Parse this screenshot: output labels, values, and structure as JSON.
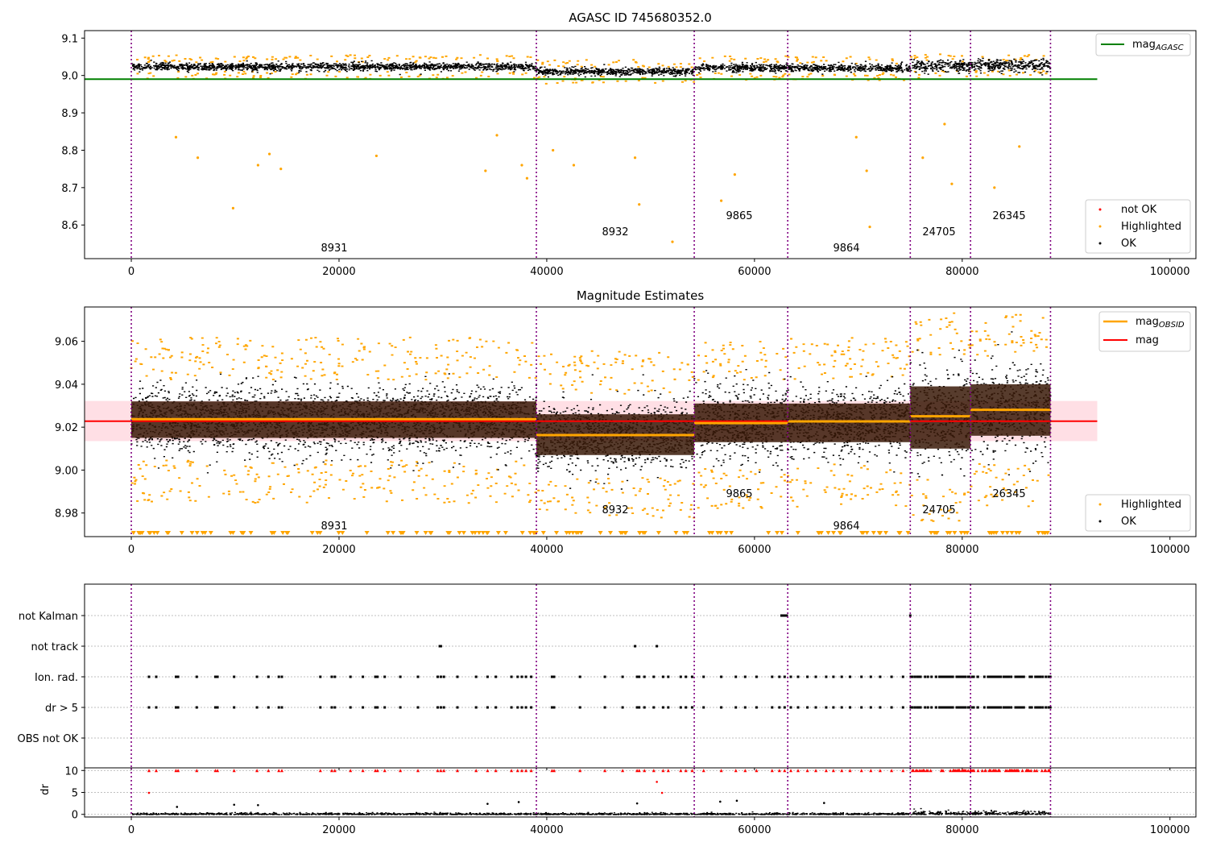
{
  "figure": {
    "obsid_labels": [
      "8931",
      "8932",
      "9865",
      "9864",
      "24705",
      "26345"
    ],
    "obs_boundaries": [
      0,
      39000,
      54200,
      63200,
      75000,
      80800,
      88500
    ]
  },
  "chart_data": [
    {
      "type": "scatter",
      "title": "AGASC ID 745680352.0",
      "xlabel": "",
      "ylabel": "",
      "xlim": [
        -4500,
        102500
      ],
      "ylim": [
        8.51,
        9.12
      ],
      "xticks": [
        "0",
        "20000",
        "40000",
        "60000",
        "80000",
        "100000"
      ],
      "yticks": [
        "8.6",
        "8.7",
        "8.8",
        "8.9",
        "9.0",
        "9.1"
      ],
      "mag_agasc": 8.99,
      "legend": {
        "position": "top-right",
        "entries": [
          "mag_AGASC"
        ]
      },
      "legend2": {
        "position": "bottom-right",
        "entries": [
          "not OK",
          "Highlighted",
          "OK"
        ]
      },
      "band_means": [
        9.025,
        9.012,
        9.022,
        9.021,
        9.027,
        9.028
      ],
      "highlighted_outliers": [
        {
          "x": 9800,
          "y": 8.645
        },
        {
          "x": 6400,
          "y": 8.78
        },
        {
          "x": 4300,
          "y": 8.835
        },
        {
          "x": 12200,
          "y": 8.76
        },
        {
          "x": 13300,
          "y": 8.79
        },
        {
          "x": 14400,
          "y": 8.75
        },
        {
          "x": 23600,
          "y": 8.785
        },
        {
          "x": 34100,
          "y": 8.745
        },
        {
          "x": 35200,
          "y": 8.84
        },
        {
          "x": 37600,
          "y": 8.76
        },
        {
          "x": 38100,
          "y": 8.725
        },
        {
          "x": 42600,
          "y": 8.76
        },
        {
          "x": 40600,
          "y": 8.8
        },
        {
          "x": 48500,
          "y": 8.78
        },
        {
          "x": 48900,
          "y": 8.655
        },
        {
          "x": 52100,
          "y": 8.555
        },
        {
          "x": 56800,
          "y": 8.665
        },
        {
          "x": 58100,
          "y": 8.735
        },
        {
          "x": 70800,
          "y": 8.745
        },
        {
          "x": 71100,
          "y": 8.595
        },
        {
          "x": 69800,
          "y": 8.835
        },
        {
          "x": 76200,
          "y": 8.78
        },
        {
          "x": 79000,
          "y": 8.71
        },
        {
          "x": 83100,
          "y": 8.7
        },
        {
          "x": 85500,
          "y": 8.81
        },
        {
          "x": 78300,
          "y": 8.87
        }
      ]
    },
    {
      "type": "scatter",
      "title": "Magnitude Estimates",
      "xlabel": "",
      "ylabel": "",
      "xlim": [
        -4500,
        102500
      ],
      "ylim": [
        8.969,
        9.076
      ],
      "xticks": [
        "0",
        "20000",
        "40000",
        "60000",
        "80000",
        "100000"
      ],
      "yticks": [
        "8.98",
        "9.00",
        "9.02",
        "9.04",
        "9.06"
      ],
      "mag": 9.0228,
      "mag_band": [
        9.0135,
        9.0322
      ],
      "legend": {
        "position": "top-right",
        "entries": [
          "mag_OBSID",
          "mag"
        ]
      },
      "legend2": {
        "position": "bottom-right",
        "entries": [
          "Highlighted",
          "OK"
        ]
      },
      "mag_obsid": [
        9.0237,
        9.0163,
        9.0219,
        9.0227,
        9.0251,
        9.0281
      ],
      "obs_bands": [
        {
          "lo": 9.015,
          "hi": 9.032
        },
        {
          "lo": 9.007,
          "hi": 9.026
        },
        {
          "lo": 9.013,
          "hi": 9.031
        },
        {
          "lo": 9.013,
          "hi": 9.031
        },
        {
          "lo": 9.01,
          "hi": 9.039
        },
        {
          "lo": 9.016,
          "hi": 9.04
        }
      ],
      "obs_spread": [
        {
          "mean": 9.0237,
          "sd": 0.0072
        },
        {
          "mean": 9.0163,
          "sd": 0.0075
        },
        {
          "mean": 9.0219,
          "sd": 0.0075
        },
        {
          "mean": 9.0227,
          "sd": 0.0075
        },
        {
          "mean": 9.0251,
          "sd": 0.011
        },
        {
          "mean": 9.0281,
          "sd": 0.0095
        }
      ]
    },
    {
      "type": "scatter",
      "title": "",
      "xlabel": "",
      "ylabel": "",
      "xlim": [
        -4500,
        102500
      ],
      "categories": [
        "not Kalman",
        "not track",
        "Ion. rad.",
        "dr > 5",
        "OBS not OK"
      ],
      "flag_points": {
        "not Kalman": [
          62600,
          62700,
          62800,
          62900,
          63000,
          63100,
          75000
        ],
        "not track": [
          29700,
          29800,
          48500,
          50600
        ],
        "Ion. rad.": [
          1700,
          2400,
          4300,
          4500,
          6300,
          8100,
          8300,
          9900,
          12100,
          13200,
          14200,
          14500,
          18200,
          19300,
          19600,
          21100,
          22300,
          23500,
          23700,
          24400,
          25900,
          27600,
          29500,
          29800,
          30100,
          31400,
          33200,
          34300,
          35100,
          36600,
          37200,
          37600,
          38000,
          38500,
          40500,
          40700,
          43200,
          45600,
          47300,
          48700,
          48900,
          49400,
          50300,
          51200,
          51700,
          52900,
          53400,
          54000,
          55100,
          56800,
          58200,
          59100,
          60200,
          61700,
          62400,
          62900,
          63500,
          64200,
          65100,
          65900,
          66900,
          67600,
          68400,
          69200,
          70300,
          71200,
          72100,
          73200,
          74300
        ],
        "dr > 5": [
          1700,
          2400,
          4300,
          4500,
          6300,
          8100,
          8300,
          9900,
          12100,
          13200,
          14200,
          14500,
          18200,
          19300,
          19600,
          21100,
          22300,
          23500,
          23700,
          24400,
          25900,
          27600,
          29500,
          29800,
          30100,
          31400,
          33200,
          34300,
          35100,
          36600,
          37200,
          37600,
          38000,
          38500,
          40500,
          40700,
          43200,
          45600,
          47300,
          48700,
          48900,
          49400,
          50300,
          51200,
          51700,
          52900,
          53400,
          54000,
          55100,
          56800,
          58200,
          59100,
          60200,
          61700,
          62400,
          62900,
          63500,
          64200,
          65100,
          65900,
          66900,
          67600,
          68400,
          69200,
          70300,
          71200,
          72100,
          73200,
          74300
        ],
        "OBS not OK": []
      }
    },
    {
      "type": "scatter",
      "title": "",
      "xlabel": "",
      "ylabel": "dr",
      "xlim": [
        -4500,
        102500
      ],
      "ylim": [
        -0.6,
        10.6
      ],
      "xticks": [
        "0",
        "20000",
        "40000",
        "60000",
        "80000",
        "100000"
      ],
      "yticks": [
        "0",
        "5",
        "10"
      ],
      "capped_value": 10,
      "dr_outliers": [
        {
          "x": 1700,
          "y": 4.9
        },
        {
          "x": 50600,
          "y": 7.4
        },
        {
          "x": 51100,
          "y": 4.9
        },
        {
          "x": 37300,
          "y": 2.8
        },
        {
          "x": 56700,
          "y": 2.9
        },
        {
          "x": 58300,
          "y": 3.1
        },
        {
          "x": 66700,
          "y": 2.6
        },
        {
          "x": 34300,
          "y": 2.4
        },
        {
          "x": 9900,
          "y": 2.2
        },
        {
          "x": 48700,
          "y": 2.5
        },
        {
          "x": 12200,
          "y": 2.1
        },
        {
          "x": 4400,
          "y": 1.7
        }
      ]
    }
  ]
}
